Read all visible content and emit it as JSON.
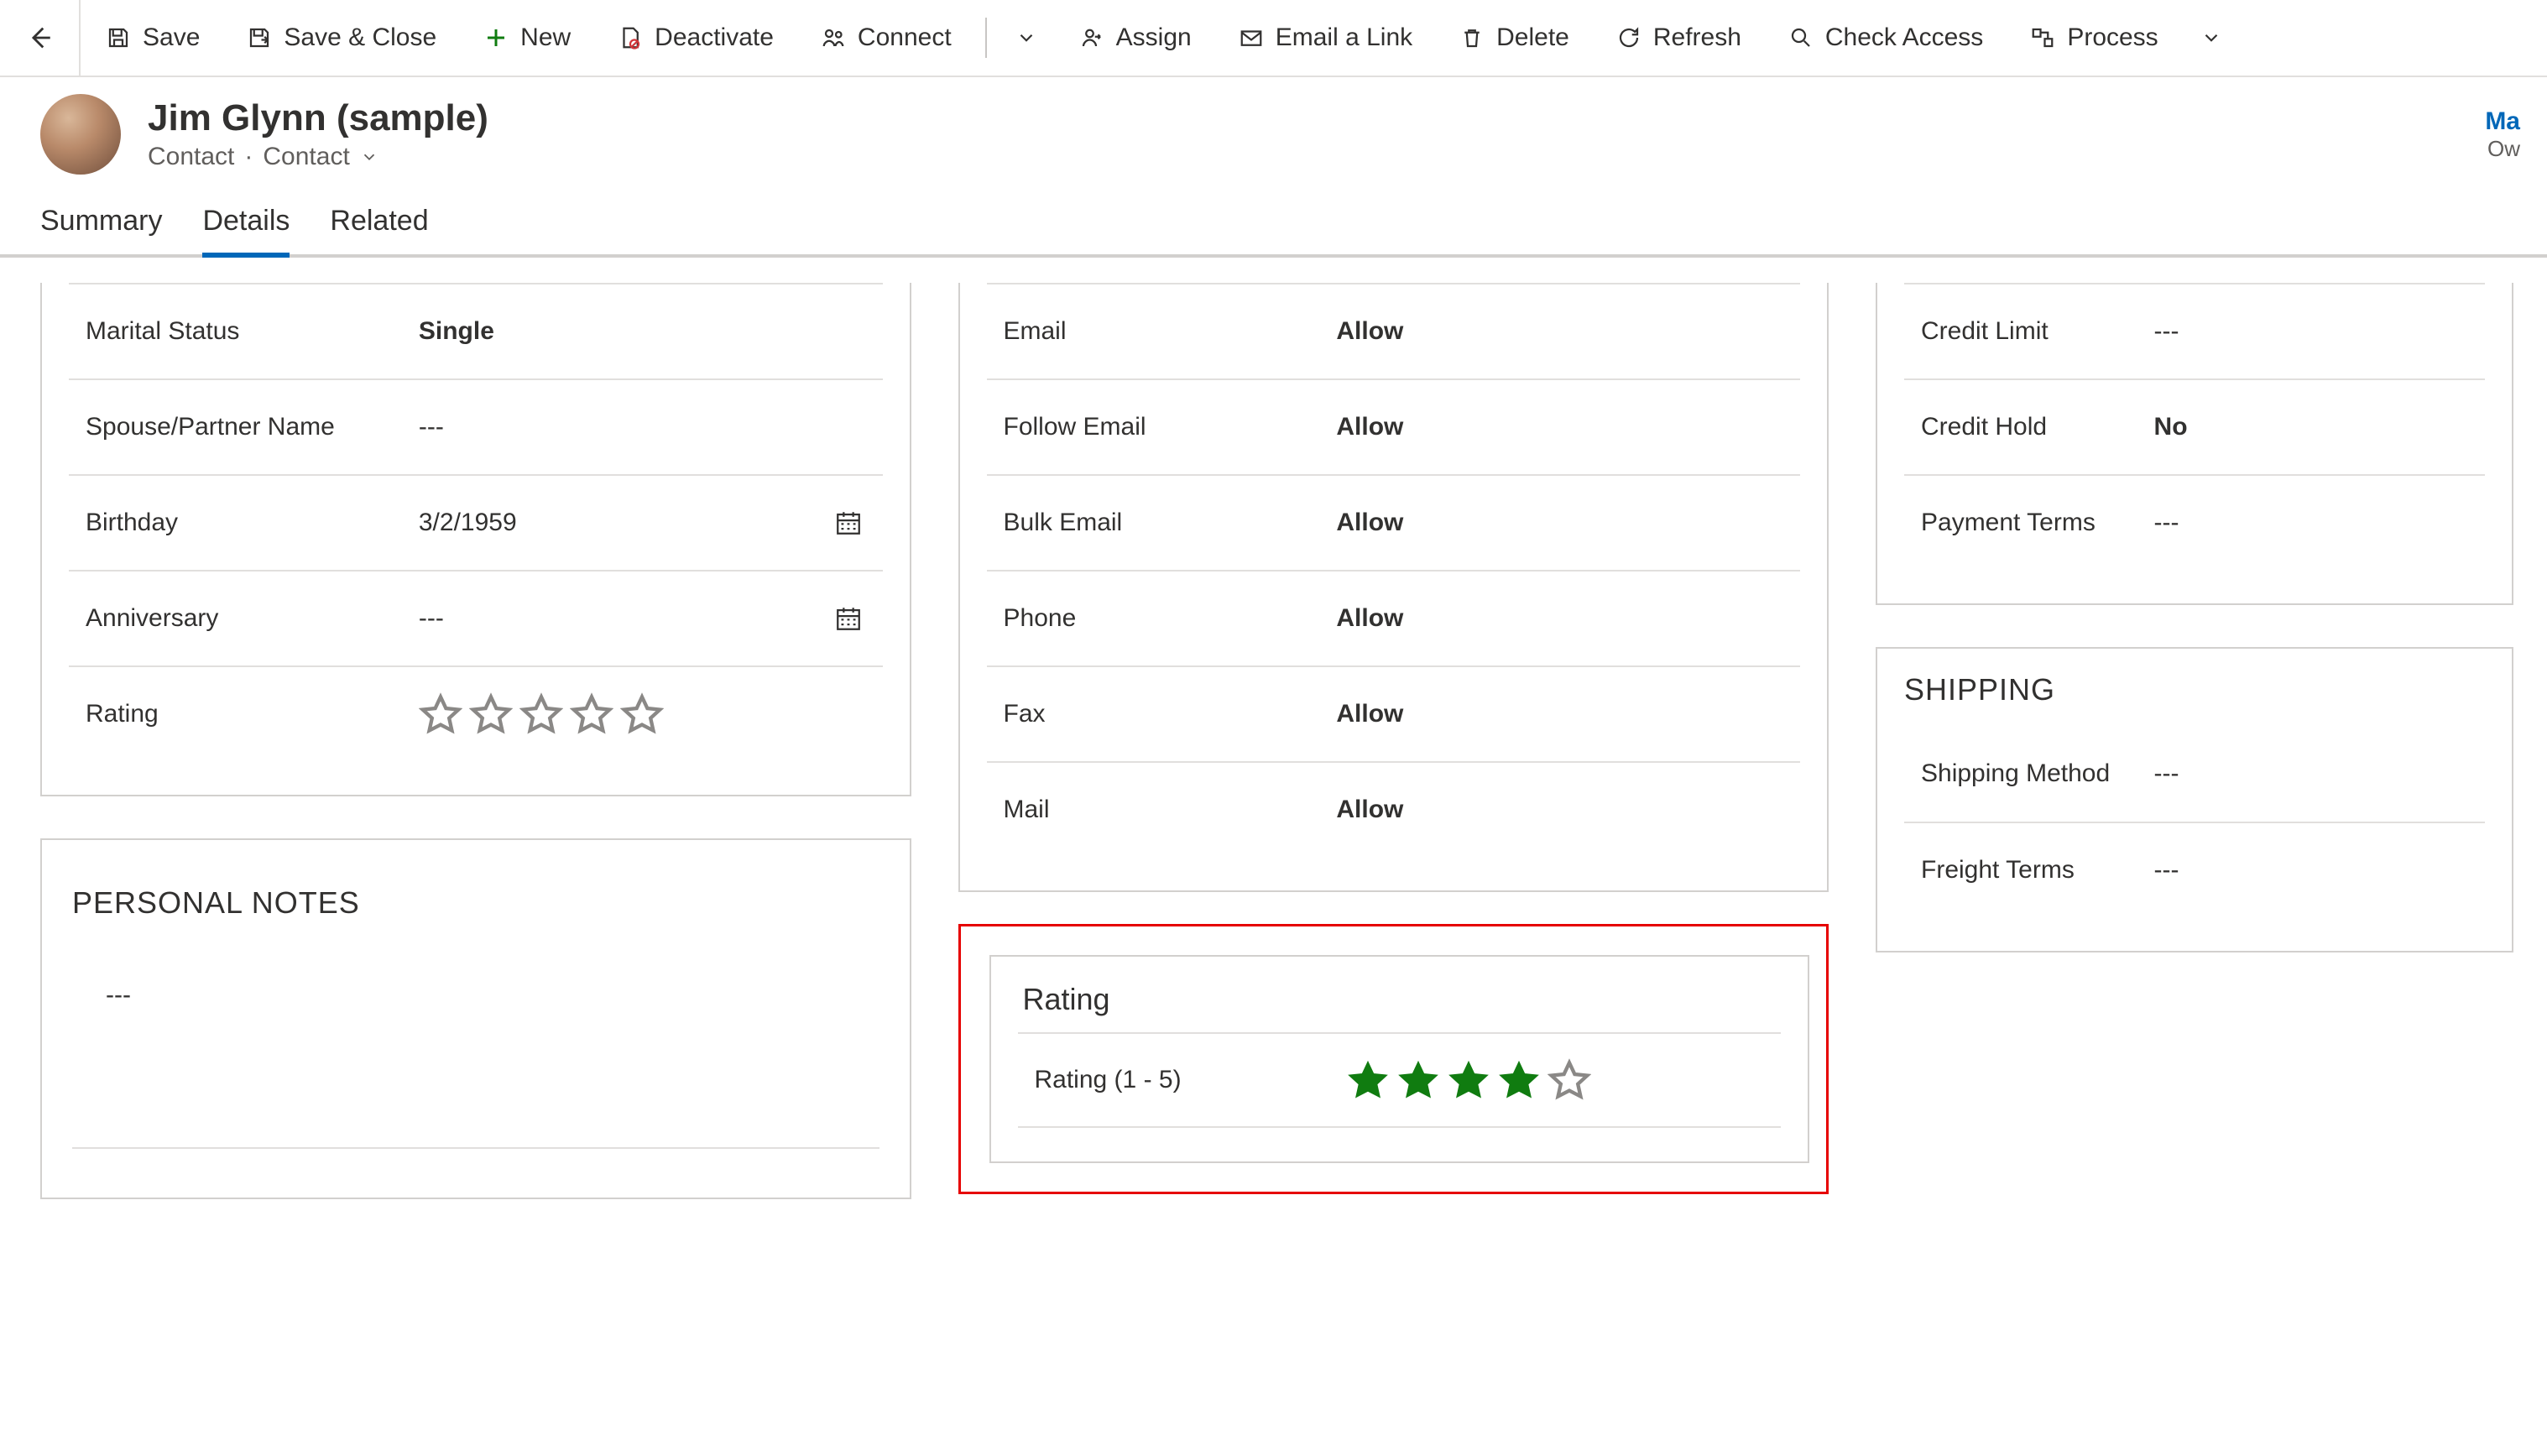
{
  "commands": {
    "save": "Save",
    "save_close": "Save & Close",
    "new": "New",
    "deactivate": "Deactivate",
    "connect": "Connect",
    "assign": "Assign",
    "email_link": "Email a Link",
    "delete": "Delete",
    "refresh": "Refresh",
    "check_access": "Check Access",
    "process": "Process"
  },
  "record": {
    "title": "Jim Glynn (sample)",
    "entity": "Contact",
    "form": "Contact",
    "owner_short1": "Ma",
    "owner_short2": "Ow"
  },
  "tabs": {
    "summary": "Summary",
    "details": "Details",
    "related": "Related"
  },
  "personal": {
    "marital_status_label": "Marital Status",
    "marital_status_value": "Single",
    "spouse_label": "Spouse/Partner Name",
    "spouse_value": "---",
    "birthday_label": "Birthday",
    "birthday_value": "3/2/1959",
    "anniversary_label": "Anniversary",
    "anniversary_value": "---",
    "rating_label": "Rating",
    "rating_value": 0
  },
  "notes": {
    "title": "PERSONAL NOTES",
    "value": "---"
  },
  "contact_prefs": {
    "email_label": "Email",
    "email_value": "Allow",
    "follow_label": "Follow Email",
    "follow_value": "Allow",
    "bulk_label": "Bulk Email",
    "bulk_value": "Allow",
    "phone_label": "Phone",
    "phone_value": "Allow",
    "fax_label": "Fax",
    "fax_value": "Allow",
    "mail_label": "Mail",
    "mail_value": "Allow"
  },
  "rating_section": {
    "title": "Rating",
    "field_label": "Rating (1 - 5)",
    "value": 4,
    "max": 5
  },
  "billing": {
    "credit_limit_label": "Credit Limit",
    "credit_limit_value": "---",
    "credit_hold_label": "Credit Hold",
    "credit_hold_value": "No",
    "payment_terms_label": "Payment Terms",
    "payment_terms_value": "---"
  },
  "shipping": {
    "title": "SHIPPING",
    "method_label": "Shipping Method",
    "method_value": "---",
    "freight_label": "Freight Terms",
    "freight_value": "---"
  }
}
